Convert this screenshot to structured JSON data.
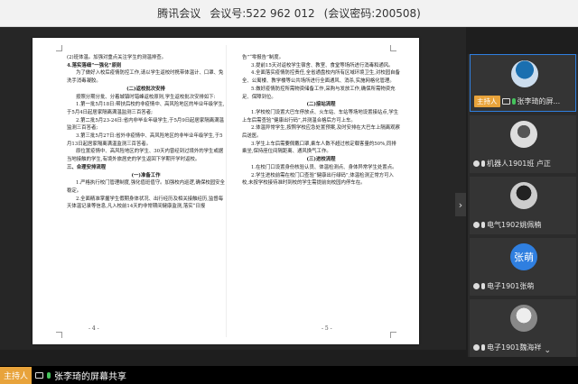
{
  "window": {
    "app_name": "腾讯会议",
    "meeting_id_label": "会议号:",
    "meeting_id": "522 962 012",
    "password_text": "(会议密码:200508)"
  },
  "document": {
    "left_page": [
      {
        "t": "(2)班体温。加强对重点关注学生的测温排查。",
        "style": "p"
      },
      {
        "t": "4.落实落细“一强化”原则",
        "style": "h"
      },
      {
        "t": "为了做好入校后疫情防控工作,请以学生返校时携带体温计、口罩、免洗手消毒凝胶。",
        "style": "p"
      },
      {
        "t": "(二)返校批次安排",
        "style": "c"
      },
      {
        "t": "按照分期分批、分着城镇时错峰返校原则,学生返校批次安排如下:",
        "style": "p"
      },
      {
        "t": "1.第一批5月18日:帮扶后校的非疫情中、高风险地区的毕业年级学生,于5月4日起居家隔离满温监测三百答者;",
        "style": "p"
      },
      {
        "t": "2.第二批5月23-24日:省内非毕业年级学生,于5月9日起居家隔离满温监测三百答者;",
        "style": "p"
      },
      {
        "t": "3.第三批5月27日:省外非疫情中、高风险地区的非毕业年级学生,于5月13日起居家隔离满温监测三百答者。",
        "style": "p"
      },
      {
        "t": "原位置疫情中、高风险地区的学生、30天内曾经到过境外的学生或据当地接触的学生,有境外旅居史的学生返回下学期开学时返校。",
        "style": "p"
      },
      {
        "t": "三、合理安排流程",
        "style": "h"
      },
      {
        "t": "(一)准备工作",
        "style": "c"
      },
      {
        "t": "1.严格执行校门管理制度,强化值班值守。加强校内巡逻,确保校园安全稳定。",
        "style": "p"
      },
      {
        "t": "2.全面精准掌握学生假期身体状况、出行经历及相关接触经历,监督每天体温记录等信息,凡入校前14天的非常期间健康监测,落实“日报",
        "style": "p"
      }
    ],
    "right_page": [
      {
        "t": "告”“零报告”制度。",
        "style": "p"
      },
      {
        "t": "3.提前15天对返校学生宿舍、教室、食堂等场所进行消毒和通风。",
        "style": "p"
      },
      {
        "t": "4.全面落实疫情防控责任,全省通盘校内所有区域环境卫生,对校园自备全、公寓楼、教学楼等公共场所进行全面通风、消杀,实施网格化管理。",
        "style": "p"
      },
      {
        "t": "5.做好疫情防控所需物资储备工作,采购与发放工作,确保所需物资充足、保障到位。",
        "style": "p"
      },
      {
        "t": "(二)接站流程",
        "style": "c"
      },
      {
        "t": "1.学校校门设置大巴车停放点、火车站、车站等场地设置接站点,学生上车后需查验“健康出行码”,并测温合格后方可上车。",
        "style": "p"
      },
      {
        "t": "2.体温异常学生,按照学校应急处置预案,及时安排在大巴车上隔离观察后送医。",
        "style": "p"
      },
      {
        "t": "3.学生上车后需要佩戴口罩,乘车人数不超过核定载客量的50%,同排乘坐,保持座位间隔距离、通风换气工作。",
        "style": "p"
      },
      {
        "t": "(三)进校流程",
        "style": "c"
      },
      {
        "t": "1.在校门口设置身份核验认员、体温检测点、身体异常学生处置点。",
        "style": "p"
      },
      {
        "t": "2.学生进校前需在校门口查验“健康出行绿码”,体温检测正常方可入校,未按学校接待准时到校的学生需提前向校园内停车在。",
        "style": "p"
      }
    ],
    "page_left_num": "- 4 -",
    "page_right_num": "- 5 -"
  },
  "participants": [
    {
      "name": "张李琦的屏...",
      "host": true,
      "host_label": "主持人",
      "avatar": "a",
      "mic": "on",
      "sharing": true
    },
    {
      "name": "机器人1901班 卢正",
      "host": false,
      "avatar": "b",
      "mic": "off"
    },
    {
      "name": "电气1902姚佩楠",
      "host": false,
      "avatar": "c",
      "mic": "off"
    },
    {
      "name": "电子1901张萌",
      "host": false,
      "avatar": "d",
      "avatar_text": "张萌",
      "mic": "off"
    },
    {
      "name": "电子1901魏海祥",
      "host": false,
      "avatar": "e",
      "mic": "off"
    }
  ],
  "bottom_bar": {
    "host_label": "主持人",
    "share_text": "张李琦的屏幕共享"
  }
}
